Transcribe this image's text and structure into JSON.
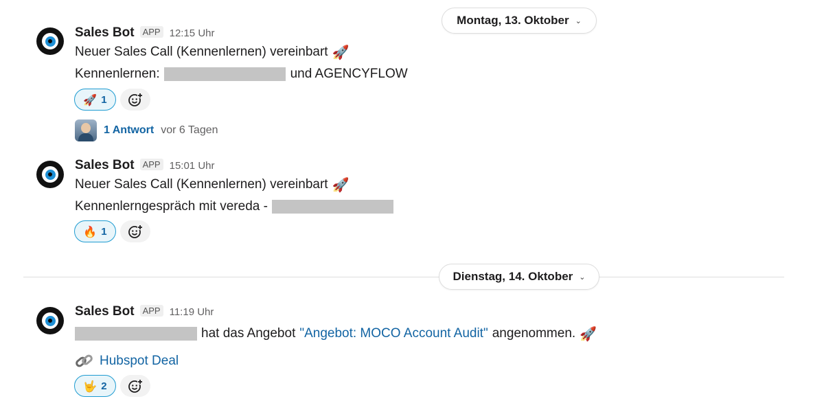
{
  "dates": [
    {
      "label": "Montag, 13. Oktober",
      "chevron": "⌄"
    },
    {
      "label": "Dienstag, 14. Oktober",
      "chevron": "⌄"
    }
  ],
  "messages": [
    {
      "sender": "Sales Bot",
      "badge": "APP",
      "time": "12:15 Uhr",
      "line1": "Neuer Sales Call (Kennenlernen) vereinbart",
      "line2_prefix": "Kennenlernen:",
      "line2_suffix": "und AGENCYFLOW",
      "reaction": {
        "emoji": "🚀",
        "count": "1"
      },
      "thread": {
        "replies": "1 Antwort",
        "ago": "vor 6 Tagen"
      }
    },
    {
      "sender": "Sales Bot",
      "badge": "APP",
      "time": "15:01 Uhr",
      "line1": "Neuer Sales Call (Kennenlernen) vereinbart",
      "line2_prefix": "Kennenlerngespräch mit vereda -",
      "reaction": {
        "emoji": "🔥",
        "count": "1"
      }
    },
    {
      "sender": "Sales Bot",
      "badge": "APP",
      "time": "11:19 Uhr",
      "line1_middle": "hat das Angebot",
      "line1_link": "\"Angebot: MOCO Account Audit\"",
      "line1_suffix": "angenommen.",
      "deal_link": "Hubspot Deal",
      "reaction": {
        "emoji": "🤟",
        "count": "2"
      }
    }
  ],
  "icons": {
    "avatar": "eye-logo",
    "rocket": "rocket-emoji",
    "add_reaction": "smiley-plus-icon",
    "link": "chain-link-icon"
  },
  "colors": {
    "link": "#1264a3",
    "reaction_border": "#1d9bd1",
    "reaction_bg": "#e8f5fa",
    "redaction": "#c4c4c4"
  }
}
